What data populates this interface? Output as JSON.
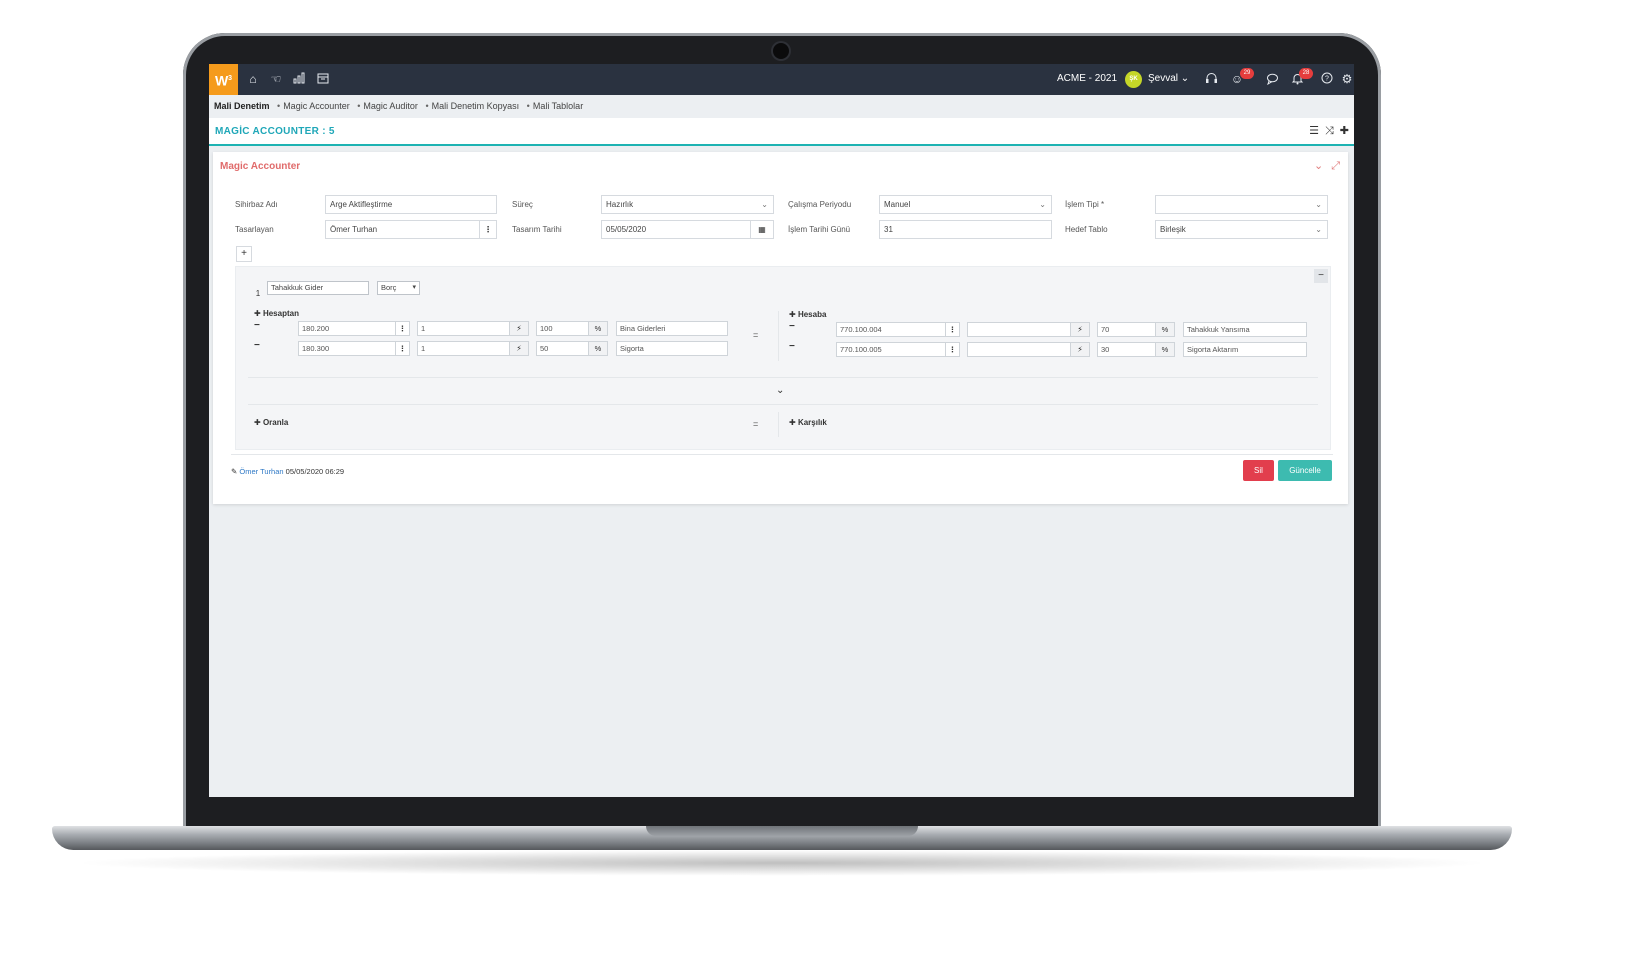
{
  "topbar": {
    "logo": "W",
    "logo_sup": "3",
    "company": "ACME - 2021",
    "avatar_initials": "ŞK",
    "username": "Şevval",
    "badges": {
      "chat_count": "29",
      "notification_count": "28"
    }
  },
  "breadcrumb": {
    "root": "Mali Denetim",
    "items": [
      "Magic Accounter",
      "Magic Auditor",
      "Mali Denetim Kopyası",
      "Mali Tablolar"
    ]
  },
  "page": {
    "title": "MAGİC ACCOUNTER : 5"
  },
  "card": {
    "title": "Magic Accounter",
    "form": {
      "sihirbaz_label": "Sihirbaz Adı",
      "sihirbaz_value": "Arge Aktifleştirme",
      "surec_label": "Süreç",
      "surec_value": "Hazırlık",
      "periyot_label": "Çalışma Periyodu",
      "periyot_value": "Manuel",
      "islem_tipi_label": "İşlem Tipi *",
      "islem_tipi_value": "",
      "tasarlayan_label": "Tasarlayan",
      "tasarlayan_value": "Ömer Turhan",
      "tasarim_label": "Tasarım Tarihi",
      "tasarim_value": "05/05/2020",
      "islem_gunu_label": "İşlem Tarihi Günü",
      "islem_gunu_value": "31",
      "hedef_label": "Hedef Tablo",
      "hedef_value": "Birleşik"
    },
    "rule": {
      "number": "1",
      "name": "Tahakkuk Gider",
      "side": "Borç",
      "from_title": "Hesaptan",
      "to_title": "Hesaba",
      "from_rows": [
        {
          "account": "180.200",
          "qty": "1",
          "pct": "100",
          "pct_sign": "%",
          "desc": "Bina Giderleri"
        },
        {
          "account": "180.300",
          "qty": "1",
          "pct": "50",
          "pct_sign": "%",
          "desc": "Sigorta"
        }
      ],
      "to_rows": [
        {
          "account": "770.100.004",
          "qty": "",
          "pct": "70",
          "pct_sign": "%",
          "desc": "Tahakkuk Yansıma"
        },
        {
          "account": "770.100.005",
          "qty": "",
          "pct": "30",
          "pct_sign": "%",
          "desc": "Sigorta Aktarım"
        }
      ],
      "equals": "=",
      "oranla": "Oranla",
      "karsilik": "Karşılık"
    },
    "footer": {
      "editor": "Ömer Turhan",
      "timestamp": "05/05/2020 06:29",
      "delete_label": "Sil",
      "update_label": "Güncelle"
    }
  },
  "colors": {
    "accent": "#1fa7b8",
    "brand": "#f59b1c",
    "danger": "#e23e4d",
    "success": "#3dbbb0",
    "topbar": "#2a3240"
  }
}
